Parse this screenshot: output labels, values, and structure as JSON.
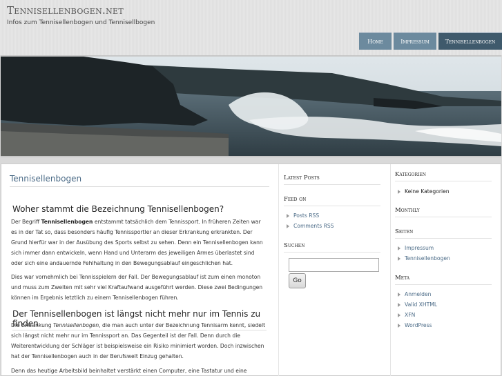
{
  "header": {
    "site_title": "Tennisellenbogen.net",
    "site_description": "Infos zum Tennisellenbogen und Tennisellbogen",
    "nav": [
      {
        "label": "Home",
        "active": false
      },
      {
        "label": "Impressum",
        "active": false
      },
      {
        "label": "Tennisellenbogen",
        "active": true
      }
    ]
  },
  "colors": {
    "nav_tab": "#6c8a9e",
    "nav_tab_active": "#3f5a6c",
    "link": "#4a6a86"
  },
  "main": {
    "page_title": "Tennisellenbogen",
    "section1": {
      "heading": "Woher stammt die Bezeichnung Tennisellenbogen?",
      "p1_before_bold": "Der Begriff ",
      "p1_bold": "Tennisellenbogen",
      "p1_after_bold": " entstammt tatsächlich dem Tennissport. In früheren Zeiten war es in der Tat so, dass besonders häufig Tennissportler an dieser Erkrankung erkrankten. Der Grund hierfür war in der Ausübung des Sports selbst zu sehen. Denn ein Tennisellenbogen kann sich immer dann entwickeln, wenn Hand und Unterarm des jeweiligen Armes überlastet sind oder sich eine andauernde Fehlhaltung in den Bewegungsablauf eingeschlichen hat.",
      "p2": "Dies war vornehmlich bei Tennisspielern der Fall. Der Bewegungsablauf ist zum einen monoton und muss zum Zweiten mit sehr viel Kraftaufwand ausgeführt werden. Diese zwei Bedingungen können im Ergebnis letztlich zu einem Tennisellenbogen führen."
    },
    "section2": {
      "heading": "Der Tennisellenbogen ist längst nicht mehr nur im Tennis zu finden",
      "p1_before_italic": "Die Erkrankung ",
      "p1_italic": "Tennisellenbogen",
      "p1_after_italic": ", die man auch unter der Bezeichnung Tennisarm kennt, siedelt sich längst nicht mehr nur im Tennissport an. Das Gegenteil ist der Fall. Denn durch die Weiterentwicklung der Schläger ist beispielsweise ein Risiko minimiert worden. Doch inzwischen hat der Tennisellenbogen auch in der Berufswelt Einzug gehalten.",
      "p2": "Denn das heutige Arbeitsbild beinhaltet verstärkt einen Computer, eine Tastatur und eine"
    }
  },
  "sidebar1": {
    "latest_posts_title": "Latest Posts",
    "feed_title": "Feed on",
    "feed_links": [
      "Posts RSS",
      "Comments RSS"
    ],
    "search_title": "Suchen",
    "search_value": "",
    "search_button": "Go"
  },
  "sidebar2": {
    "categories_title": "Kategorien",
    "categories_items": [
      "Keine Kategorien"
    ],
    "monthly_title": "Monthly",
    "pages_title": "Seiten",
    "pages_links": [
      "Impressum",
      "Tennisellenbogen"
    ],
    "meta_title": "Meta",
    "meta_links": [
      "Anmelden",
      "Valid XHTML",
      "XFN",
      "WordPress"
    ]
  }
}
